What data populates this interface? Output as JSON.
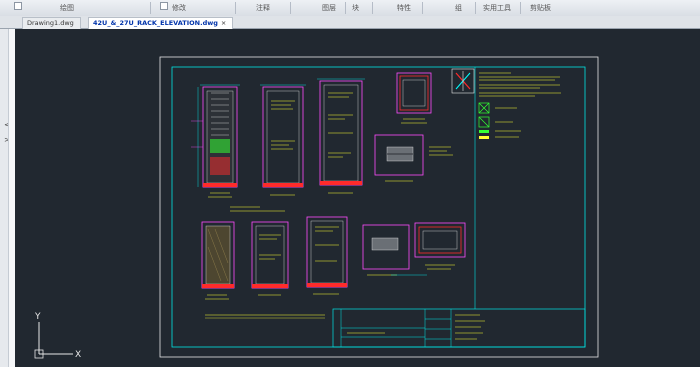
{
  "ribbon": {
    "groups": [
      "绘图",
      "修改",
      "注释",
      "图层",
      "块",
      "特性",
      "组",
      "实用工具",
      "剪贴板"
    ]
  },
  "tabs": [
    {
      "label": "Drawing1.dwg",
      "active": false
    },
    {
      "label": "42U_&_27U_RACK_ELEVATION.dwg",
      "active": true
    }
  ],
  "leftbar": {
    "expand_glyph": "<",
    "collapse_glyph": ">"
  },
  "ucs": {
    "y_label": "Y",
    "x_label": "X"
  },
  "colors": {
    "canvas": "#212830",
    "border": "#00e5e5",
    "rack_outline": "#ff4cff",
    "dimension": "#00ffff",
    "text_yellow": "#ffff33",
    "red": "#ff2b2b",
    "green": "#33ff33",
    "white": "#e8e8e8"
  }
}
